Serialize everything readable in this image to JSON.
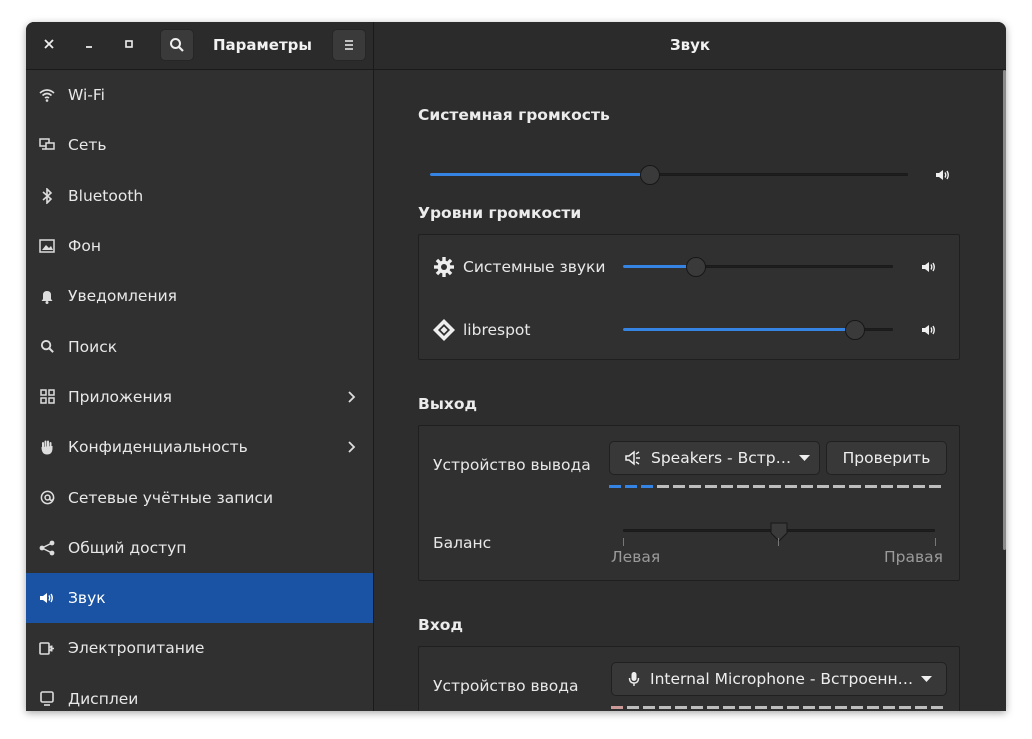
{
  "sidebar_title": "Параметры",
  "page_title": "Звук",
  "sidebar": {
    "items": [
      {
        "label": "Wi-Fi",
        "icon": "wifi-icon"
      },
      {
        "label": "Сеть",
        "icon": "network-icon"
      },
      {
        "label": "Bluetooth",
        "icon": "bluetooth-icon"
      },
      {
        "label": "Фон",
        "icon": "background-icon"
      },
      {
        "label": "Уведомления",
        "icon": "bell-icon"
      },
      {
        "label": "Поиск",
        "icon": "search-icon"
      },
      {
        "label": "Приложения",
        "icon": "apps-icon"
      },
      {
        "label": "Конфиденциальность",
        "icon": "hand-icon"
      },
      {
        "label": "Сетевые учётные записи",
        "icon": "at-icon"
      },
      {
        "label": "Общий доступ",
        "icon": "share-icon"
      },
      {
        "label": "Звук",
        "icon": "speaker-icon"
      },
      {
        "label": "Электропитание",
        "icon": "power-plug-icon"
      },
      {
        "label": "Дисплеи",
        "icon": "display-icon"
      }
    ],
    "active": "Звук"
  },
  "system_volume": {
    "heading": "Системная громкость",
    "level": 0.46
  },
  "volume_levels": {
    "heading": "Уровни громкости",
    "rows": [
      {
        "label": "Системные звуки",
        "level": 0.27
      },
      {
        "label": "librespot",
        "level": 0.86
      }
    ]
  },
  "output": {
    "heading": "Выход",
    "device_label": "Устройство вывода",
    "device_value": "Speakers - Встр…",
    "test_button": "Проверить",
    "balance_label": "Баланс",
    "balance_left": "Левая",
    "balance_right": "Правая",
    "balance": 0.5,
    "level_active_segments": 3
  },
  "input": {
    "heading": "Вход",
    "device_label": "Устройство ввода",
    "device_value": "Internal Microphone - Встроенн…"
  },
  "colors": {
    "accent": "#3584e4",
    "selected": "#1a53a3"
  }
}
